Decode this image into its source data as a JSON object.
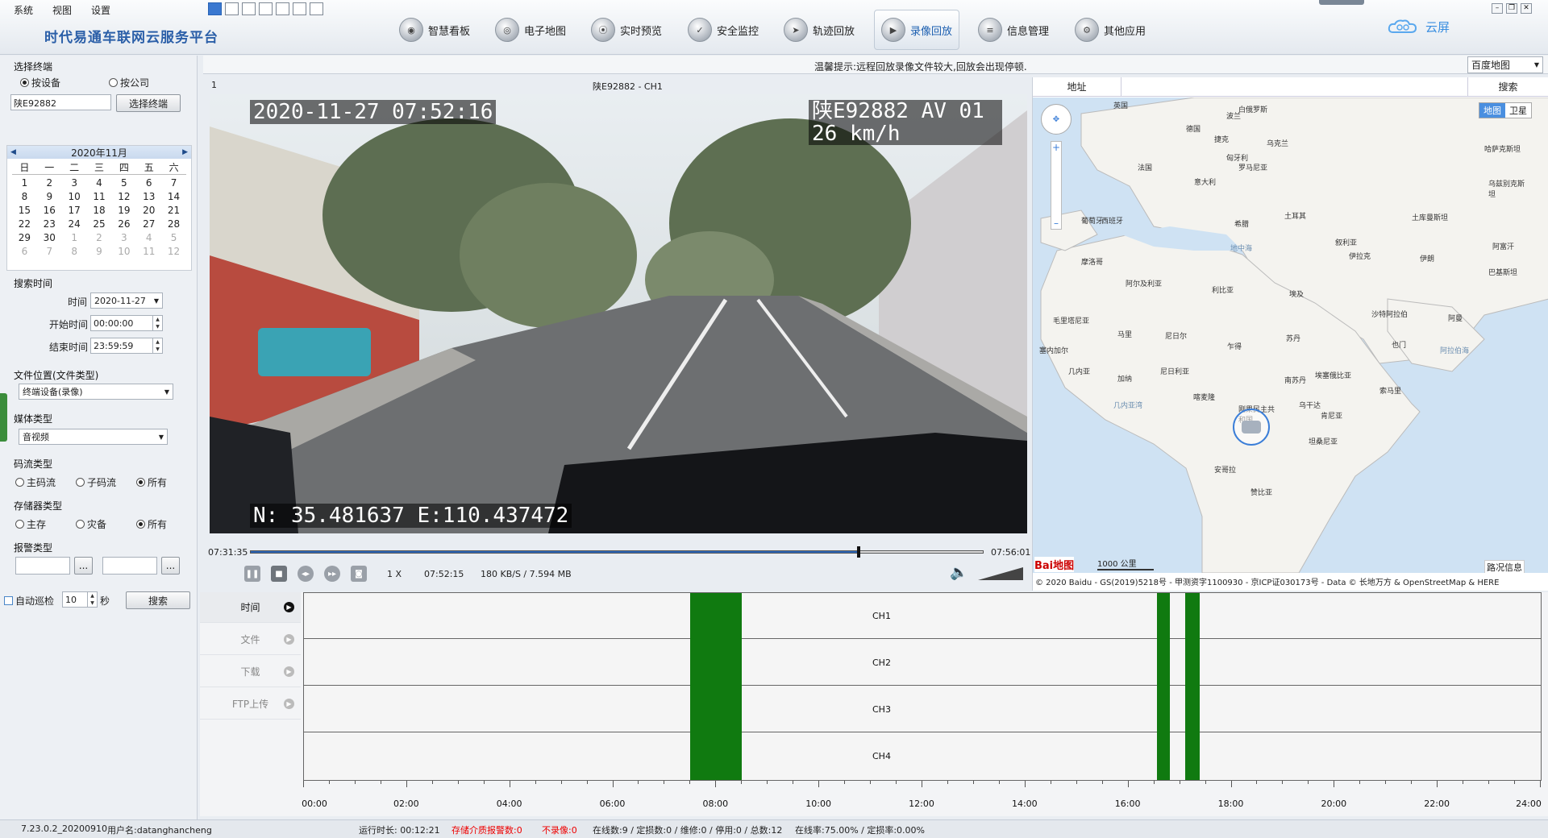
{
  "menu": [
    "系统",
    "视图",
    "设置"
  ],
  "app_title": "时代易通车联网云服务平台",
  "nav": [
    {
      "label": "智慧看板"
    },
    {
      "label": "电子地图"
    },
    {
      "label": "实时预览"
    },
    {
      "label": "安全监控"
    },
    {
      "label": "轨迹回放"
    },
    {
      "label": "录像回放"
    },
    {
      "label": "信息管理"
    },
    {
      "label": "其他应用"
    }
  ],
  "cloud_label": "云屏",
  "left": {
    "select_terminal": "选择终端",
    "by_device": "按设备",
    "by_company": "按公司",
    "terminal_value": "陕E92882",
    "select_button": "选择终端",
    "calendar": {
      "month": "2020年11月",
      "weekdays": [
        "日",
        "一",
        "二",
        "三",
        "四",
        "五",
        "六"
      ],
      "rows": [
        [
          "1",
          "2",
          "3",
          "4",
          "5",
          "6",
          "7"
        ],
        [
          "8",
          "9",
          "10",
          "11",
          "12",
          "13",
          "14"
        ],
        [
          "15",
          "16",
          "17",
          "18",
          "19",
          "20",
          "21"
        ],
        [
          "22",
          "23",
          "24",
          "25",
          "26",
          "27",
          "28"
        ],
        [
          "29",
          "30",
          "1",
          "2",
          "3",
          "4",
          "5"
        ],
        [
          "6",
          "7",
          "8",
          "9",
          "10",
          "11",
          "12"
        ]
      ]
    },
    "search_time": "搜索时间",
    "time_label": "时间",
    "time_value": "2020-11-27",
    "start_label": "开始时间",
    "start_value": "00:00:00",
    "end_label": "结束时间",
    "end_value": "23:59:59",
    "file_loc": "文件位置(文件类型)",
    "file_loc_value": "终端设备(录像)",
    "media_type": "媒体类型",
    "media_value": "音视频",
    "stream_type": "码流类型",
    "stream_opts": [
      "主码流",
      "子码流",
      "所有"
    ],
    "storage_type": "存储器类型",
    "storage_opts": [
      "主存",
      "灾备",
      "所有"
    ],
    "alarm_type": "报警类型",
    "auto_patrol": "自动巡检",
    "patrol_value": "10",
    "sec_unit": "秒",
    "search_button": "搜索",
    "ellipsis": "..."
  },
  "toolbar": {
    "notice": "温馨提示:远程回放录像文件较大,回放会出现停顿.",
    "map_select": "百度地图"
  },
  "video": {
    "index": "1",
    "title": "陕E92882 - CH1",
    "osd_time": "2020-11-27 07:52:16",
    "osd_plate": "陕E92882 AV 01",
    "osd_speed": "26 km/h",
    "osd_gps": "N: 35.481637 E:110.437472",
    "start_time": "07:31:35",
    "end_time": "07:56:01",
    "progress": 0.83,
    "speed": "1 X",
    "cur_time": "07:52:15",
    "rate": "180 KB/S / 7.594 MB"
  },
  "map": {
    "addr_label": "地址",
    "search_label": "搜索",
    "type_map": "地图",
    "type_sat": "卫星",
    "scale": "1000 公里",
    "traffic": "路况信息",
    "baidu": "Bai地图",
    "copyright": "© 2020 Baidu - GS(2019)5218号 - 甲测资字1100930 - 京ICP证030173号 - Data © 长地万方 & OpenStreetMap & HERE",
    "places": [
      {
        "t": "英国"
      },
      {
        "t": "白俄罗斯"
      },
      {
        "t": "德国"
      },
      {
        "t": "波兰"
      },
      {
        "t": "捷克"
      },
      {
        "t": "乌克兰"
      },
      {
        "t": "法国"
      },
      {
        "t": "匈牙利"
      },
      {
        "t": "罗马尼亚"
      },
      {
        "t": "哈萨克斯坦"
      },
      {
        "t": "意大利"
      },
      {
        "t": "乌兹别克斯坦"
      },
      {
        "t": "葡萄牙"
      },
      {
        "t": "西班牙"
      },
      {
        "t": "希腊"
      },
      {
        "t": "土耳其"
      },
      {
        "t": "土库曼斯坦"
      },
      {
        "t": "叙利亚"
      },
      {
        "t": "伊拉克"
      },
      {
        "t": "伊朗"
      },
      {
        "t": "阿富汗"
      },
      {
        "t": "巴基斯坦"
      },
      {
        "t": "摩洛哥"
      },
      {
        "t": "阿尔及利亚"
      },
      {
        "t": "利比亚"
      },
      {
        "t": "埃及"
      },
      {
        "t": "沙特阿拉伯"
      },
      {
        "t": "阿曼"
      },
      {
        "t": "毛里塔尼亚"
      },
      {
        "t": "马里"
      },
      {
        "t": "尼日尔"
      },
      {
        "t": "苏丹"
      },
      {
        "t": "乍得"
      },
      {
        "t": "也门"
      },
      {
        "t": "塞内加尔"
      },
      {
        "t": "几内亚"
      },
      {
        "t": "尼日利亚"
      },
      {
        "t": "埃塞俄比亚"
      },
      {
        "t": "加纳"
      },
      {
        "t": "南苏丹"
      },
      {
        "t": "索马里"
      },
      {
        "t": "喀麦隆"
      },
      {
        "t": "刚果民主共和国"
      },
      {
        "t": "肯尼亚"
      },
      {
        "t": "乌干达"
      },
      {
        "t": "坦桑尼亚"
      },
      {
        "t": "安哥拉"
      },
      {
        "t": "赞比亚"
      }
    ],
    "seas": [
      {
        "t": "地中海"
      },
      {
        "t": "几内亚湾"
      },
      {
        "t": "阿拉伯海"
      }
    ]
  },
  "timeline": {
    "tabs": [
      "时间",
      "文件",
      "下载",
      "FTP上传"
    ],
    "channels": [
      "CH1",
      "CH2",
      "CH3",
      "CH4"
    ],
    "hours": [
      "00:00",
      "02:00",
      "04:00",
      "06:00",
      "08:00",
      "10:00",
      "12:00",
      "14:00",
      "16:00",
      "18:00",
      "20:00",
      "22:00",
      "24:00"
    ],
    "segments": [
      {
        "start": 7.5,
        "end": 8.5
      },
      {
        "start": 16.55,
        "end": 16.8
      },
      {
        "start": 17.1,
        "end": 17.38
      }
    ]
  },
  "status": {
    "version": "7.23.0.2_20200910",
    "user": "用户名:datanghancheng",
    "runtime": "运行时长: 00:12:21",
    "storage_alarm": "存储介质报警数:0",
    "no_record": "不录像:0",
    "counts": "在线数:9 / 定损数:0 / 维修:0 / 停用:0 / 总数:12",
    "rates": "在线率:75.00% / 定损率:0.00%"
  }
}
